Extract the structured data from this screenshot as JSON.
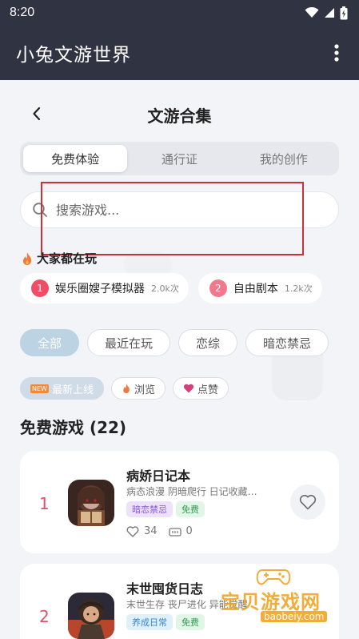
{
  "status_bar": {
    "time": "8:20"
  },
  "app_bar": {
    "title": "小兔文游世界"
  },
  "header": {
    "title": "文游合集"
  },
  "tabs": [
    {
      "label": "免费体验",
      "active": true
    },
    {
      "label": "通行证",
      "active": false
    },
    {
      "label": "我的创作",
      "active": false
    }
  ],
  "search": {
    "placeholder": "搜索游戏..."
  },
  "hot": {
    "title": "大家都在玩",
    "items": [
      {
        "rank": "1",
        "name": "娱乐圈嫂子模拟器",
        "count": "2.0k次",
        "color": "#ef4d66"
      },
      {
        "rank": "2",
        "name": "自由剧本",
        "count": "1.2k次",
        "color": "#f07a8c"
      }
    ]
  },
  "filters": [
    {
      "label": "全部",
      "active": true
    },
    {
      "label": "最近在玩",
      "active": false
    },
    {
      "label": "恋综",
      "active": false
    },
    {
      "label": "暗恋禁忌",
      "active": false
    }
  ],
  "sorts": [
    {
      "label": "最新上线",
      "badge": "NEW",
      "active": true
    },
    {
      "label": "浏览",
      "active": false
    },
    {
      "label": "点赞",
      "active": false
    }
  ],
  "section": {
    "title": "免费游戏 (22)"
  },
  "games": [
    {
      "rank": "1",
      "name": "病娇日记本",
      "desc": "病态浪漫 阴暗爬行 日记收藏…",
      "tags": [
        "暗恋禁忌",
        "免费"
      ],
      "likes": "34",
      "plays": "0"
    },
    {
      "rank": "2",
      "name": "末世囤货日志",
      "desc": "末世生存 丧尸进化 异能觉醒",
      "tags": [
        "养成日常",
        "免费"
      ]
    }
  ],
  "watermark": {
    "text": "宝贝游戏网",
    "url": "baobeiy.com"
  },
  "colors": {
    "appbar": "#303442",
    "accent_pink": "#e0506a",
    "chip_active": "#bcd3e4"
  }
}
